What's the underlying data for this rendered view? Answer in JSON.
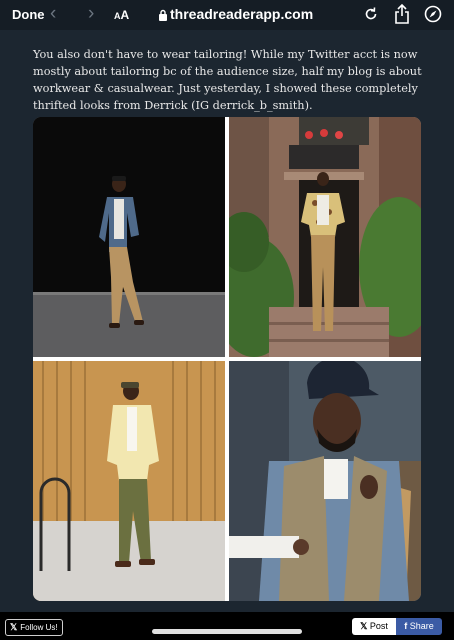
{
  "browser": {
    "done_label": "Done",
    "text_size_label": "AA",
    "url": "threadreaderapp.com",
    "icons": [
      "back-icon",
      "forward-icon",
      "lock-icon",
      "reload-icon",
      "share-icon",
      "compass-icon"
    ]
  },
  "content": {
    "paragraph": "You also don't have to wear tailoring! While my Twitter acct is now mostly about tailoring bc of the audience size, half my blog is about workwear & casualwear. Just yesterday, I showed these completely thrifted looks from Derrick (IG derrick_b_smith).",
    "photos": [
      {
        "description": "Man in denim jacket and khaki cargo pants against black wall"
      },
      {
        "description": "Man in patterned short-sleeve shirt and khaki pants on brownstone steps"
      },
      {
        "description": "Man in yellow jacket and olive pants against rusted corrugated wall"
      },
      {
        "description": "Bearded man in navy cap and utility vest holding a bag"
      }
    ]
  },
  "bottom": {
    "follow_label": "Follow Us!",
    "post_label": "Post",
    "share_label": "Share"
  },
  "colors": {
    "background": "#1c2630",
    "topbar": "#151d25",
    "share_button": "#3b5ba5"
  }
}
